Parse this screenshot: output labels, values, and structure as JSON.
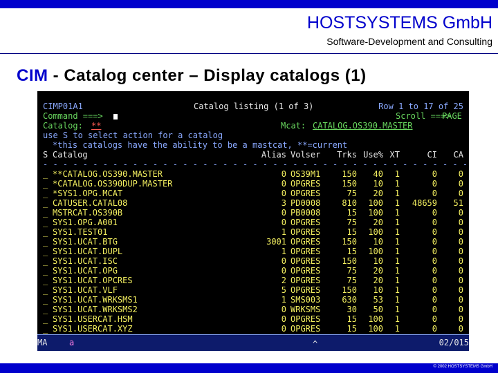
{
  "header": {
    "company": "HOSTSYSTEMS GmbH",
    "tagline": "Software-Development and Consulting",
    "title_accent": "CIM",
    "title_rest": " - Catalog center – Display catalogs (1)",
    "copyright": "© 2002 HOSTSYSTEMS GmbH"
  },
  "colors": {
    "brand_blue": "#0000cc",
    "terminal_bg": "#000000",
    "blue_text": "#8aa9ff",
    "green_text": "#69d85f",
    "yellow_text": "#f4f060",
    "red_text": "#ff5b52"
  },
  "screen": {
    "panel_id": "CIMP01A1",
    "panel_title": "Catalog listing (1 of 3)",
    "row_info": "Row 1 to 17 of 25",
    "command_label": "Command ===>",
    "command_value": "",
    "scroll_label": "Scroll ===>",
    "scroll_value": "PAGE",
    "catalog_label": "Catalog:",
    "catalog_value": "**",
    "mcat_label": "Mcat:",
    "mcat_value": "CATALOG.OS390.MASTER",
    "instruction1": "use S to select action for a catalog",
    "instruction2": "*this catalogs have the ability to be a mastcat, **=current",
    "columns": {
      "s": "S",
      "catalog": "Catalog",
      "alias": "Alias",
      "volser": "Volser",
      "trks": "Trks",
      "use": "Use%",
      "xt": "XT",
      "ci": "CI",
      "ca": "CA"
    },
    "dashes": "- - - - - - - - - - - - - - - - - - - - - - - - - - - - - - - - - - - - - - - - - - - - - -",
    "rows": [
      {
        "s": "_",
        "catalog": "**CATALOG.OS390.MASTER",
        "alias": "0",
        "volser": "OS39M1",
        "trks": "150",
        "use": "40",
        "xt": "1",
        "ci": "0",
        "ca": "0"
      },
      {
        "s": "_",
        "catalog": "*CATALOG.OS390DUP.MASTER",
        "alias": "0",
        "volser": "OPGRES",
        "trks": "150",
        "use": "10",
        "xt": "1",
        "ci": "0",
        "ca": "0"
      },
      {
        "s": "_",
        "catalog": "*SYS1.OPG.MCAT",
        "alias": "0",
        "volser": "OPGRES",
        "trks": "75",
        "use": "20",
        "xt": "1",
        "ci": "0",
        "ca": "0"
      },
      {
        "s": "_",
        "catalog": "CATUSER.CATAL08",
        "alias": "3",
        "volser": "PD0008",
        "trks": "810",
        "use": "100",
        "xt": "1",
        "ci": "48659",
        "ca": "51"
      },
      {
        "s": "_",
        "catalog": "MSTRCAT.OS390B",
        "alias": "0",
        "volser": "PB0008",
        "trks": "15",
        "use": "100",
        "xt": "1",
        "ci": "0",
        "ca": "0"
      },
      {
        "s": "_",
        "catalog": "SYS1.OPG.A001",
        "alias": "0",
        "volser": "OPGRES",
        "trks": "75",
        "use": "20",
        "xt": "1",
        "ci": "0",
        "ca": "0"
      },
      {
        "s": "_",
        "catalog": "SYS1.TEST01",
        "alias": "1",
        "volser": "OPGRES",
        "trks": "15",
        "use": "100",
        "xt": "1",
        "ci": "0",
        "ca": "0"
      },
      {
        "s": "_",
        "catalog": "SYS1.UCAT.BTG",
        "alias": "3001",
        "volser": "OPGRES",
        "trks": "150",
        "use": "10",
        "xt": "1",
        "ci": "0",
        "ca": "0"
      },
      {
        "s": "_",
        "catalog": "SYS1.UCAT.DUPL",
        "alias": "1",
        "volser": "OPGRES",
        "trks": "15",
        "use": "100",
        "xt": "1",
        "ci": "0",
        "ca": "0"
      },
      {
        "s": "_",
        "catalog": "SYS1.UCAT.ISC",
        "alias": "0",
        "volser": "OPGRES",
        "trks": "150",
        "use": "10",
        "xt": "1",
        "ci": "0",
        "ca": "0"
      },
      {
        "s": "_",
        "catalog": "SYS1.UCAT.OPG",
        "alias": "0",
        "volser": "OPGRES",
        "trks": "75",
        "use": "20",
        "xt": "1",
        "ci": "0",
        "ca": "0"
      },
      {
        "s": "_",
        "catalog": "SYS1.UCAT.OPCRES",
        "alias": "2",
        "volser": "OPGRES",
        "trks": "75",
        "use": "20",
        "xt": "1",
        "ci": "0",
        "ca": "0"
      },
      {
        "s": "_",
        "catalog": "SYS1.UCAT.VLF",
        "alias": "5",
        "volser": "OPGRES",
        "trks": "150",
        "use": "10",
        "xt": "1",
        "ci": "0",
        "ca": "0"
      },
      {
        "s": "_",
        "catalog": "SYS1.UCAT.WRKSMS1",
        "alias": "1",
        "volser": "SMS003",
        "trks": "630",
        "use": "53",
        "xt": "1",
        "ci": "0",
        "ca": "0"
      },
      {
        "s": "_",
        "catalog": "SYS1.UCAT.WRKSMS2",
        "alias": "0",
        "volser": "WRKSMS",
        "trks": "30",
        "use": "50",
        "xt": "1",
        "ci": "0",
        "ca": "0"
      },
      {
        "s": "_",
        "catalog": "SYS1.USERCAT.HSM",
        "alias": "0",
        "volser": "OPGRES",
        "trks": "15",
        "use": "100",
        "xt": "1",
        "ci": "0",
        "ca": "0"
      },
      {
        "s": "_",
        "catalog": "SYS1.USERCAT.XYZ",
        "alias": "0",
        "volser": "OPGRES",
        "trks": "15",
        "use": "100",
        "xt": "1",
        "ci": "0",
        "ca": "0"
      }
    ],
    "status": {
      "indicator": "MA",
      "session": "a",
      "caret": "^",
      "position": "02/015"
    }
  }
}
